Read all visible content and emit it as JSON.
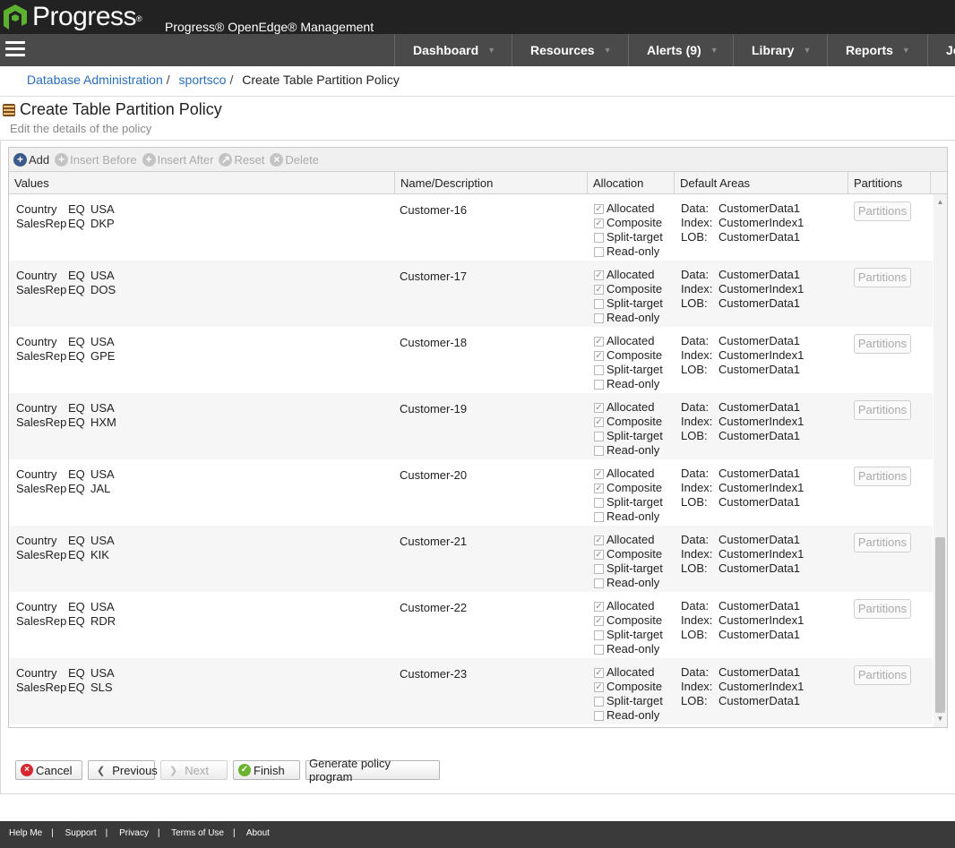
{
  "header": {
    "brand": "Progress",
    "product_html": "Progress® OpenEdge® Management",
    "nav": [
      {
        "label": "Dashboard"
      },
      {
        "label": "Resources"
      },
      {
        "label": "Alerts (9)"
      },
      {
        "label": "Library"
      },
      {
        "label": "Reports"
      },
      {
        "label": "Jo"
      }
    ]
  },
  "breadcrumb": {
    "items": [
      "Database Administration",
      "sportsco"
    ],
    "current": "Create Table Partition Policy"
  },
  "page": {
    "title": "Create Table Partition Policy",
    "subtitle": "Edit the details of the policy"
  },
  "toolbar": {
    "add": "Add",
    "insert_before": "Insert Before",
    "insert_after": "Insert After",
    "reset": "Reset",
    "delete": "Delete"
  },
  "columns": [
    "Values",
    "Name/Description",
    "Allocation",
    "Default Areas",
    "Partitions"
  ],
  "row_template": {
    "field1": "Country",
    "field2": "SalesRep",
    "op": "EQ",
    "value1": "USA",
    "alloc_labels": [
      "Allocated",
      "Composite",
      "Split-target",
      "Read-only"
    ],
    "area_labels": [
      "Data:",
      "Index:",
      "LOB:"
    ],
    "area_values": [
      "CustomerData1",
      "CustomerIndex1",
      "CustomerData1"
    ],
    "partitions_button": "Partitions"
  },
  "rows": [
    {
      "rep": "DKP",
      "name": "Customer-16",
      "allocated": true,
      "composite": true,
      "split": false,
      "readonly": false
    },
    {
      "rep": "DOS",
      "name": "Customer-17",
      "allocated": true,
      "composite": true,
      "split": false,
      "readonly": false
    },
    {
      "rep": "GPE",
      "name": "Customer-18",
      "allocated": true,
      "composite": true,
      "split": false,
      "readonly": false
    },
    {
      "rep": "HXM",
      "name": "Customer-19",
      "allocated": true,
      "composite": true,
      "split": false,
      "readonly": false
    },
    {
      "rep": "JAL",
      "name": "Customer-20",
      "allocated": true,
      "composite": true,
      "split": false,
      "readonly": false
    },
    {
      "rep": "KIK",
      "name": "Customer-21",
      "allocated": true,
      "composite": true,
      "split": false,
      "readonly": false
    },
    {
      "rep": "RDR",
      "name": "Customer-22",
      "allocated": true,
      "composite": true,
      "split": false,
      "readonly": false
    },
    {
      "rep": "SLS",
      "name": "Customer-23",
      "allocated": true,
      "composite": true,
      "split": false,
      "readonly": false
    }
  ],
  "buttons": {
    "cancel": "Cancel",
    "previous": "Previous",
    "next": "Next",
    "finish": "Finish",
    "generate": "Generate policy program"
  },
  "footer": {
    "links": [
      "Help Me",
      "Support",
      "Privacy",
      "Terms of Use",
      "About"
    ]
  },
  "colors": {
    "brand_green": "#5cb230",
    "link_blue": "#2a6ebb",
    "cancel_red": "#d7282f",
    "finish_green": "#6ab42e"
  }
}
